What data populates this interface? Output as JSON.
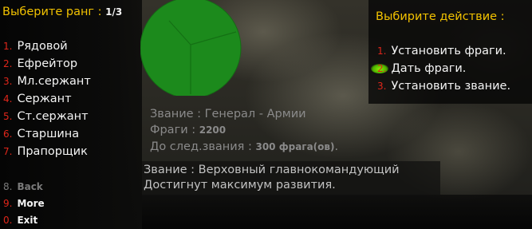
{
  "title": {
    "label": "Выберите ранг",
    "separator": " : ",
    "page": "1/3"
  },
  "rank_menu": {
    "items": [
      {
        "num": "1.",
        "label": "Рядовой"
      },
      {
        "num": "2.",
        "label": "Ефрейтор"
      },
      {
        "num": "3.",
        "label": "Мл.сержант"
      },
      {
        "num": "4.",
        "label": "Сержант"
      },
      {
        "num": "5.",
        "label": "Ст.сержант"
      },
      {
        "num": "6.",
        "label": "Старшина"
      },
      {
        "num": "7.",
        "label": "Прапорщик"
      }
    ],
    "nav": [
      {
        "num": "8.",
        "label": "Back",
        "state": "disabled"
      },
      {
        "num": "9.",
        "label": "More",
        "state": "enabled"
      },
      {
        "num": "0.",
        "label": "Exit",
        "state": "enabled"
      }
    ]
  },
  "action_menu": {
    "title": "Выбирите действие :",
    "items": [
      {
        "num": "1.",
        "label": "Установить фраги."
      },
      {
        "num": "2.",
        "label": "Дать фраги.",
        "selected": true
      },
      {
        "num": "3.",
        "label": "Установить звание."
      }
    ]
  },
  "player_stats": {
    "rank_label": "Звание : ",
    "rank_value": "Генерал - Армии",
    "frags_label": "Фраги : ",
    "frags_value": "2200",
    "next_label": "До след.звания : ",
    "next_value": "300 фрага(ов)",
    "next_suffix": "."
  },
  "rank_info": {
    "line1": "Звание : Верховный главнокомандующий",
    "line2": "Достигнут максимум развития."
  },
  "colors": {
    "title": "#f2c200",
    "number": "#e0261a",
    "text": "#f4f4f4",
    "disabled": "#7a7a7a",
    "radar": "#1e8a1e"
  },
  "icons": {
    "radar": "radar-icon",
    "selection": "selection-highlight-icon"
  }
}
